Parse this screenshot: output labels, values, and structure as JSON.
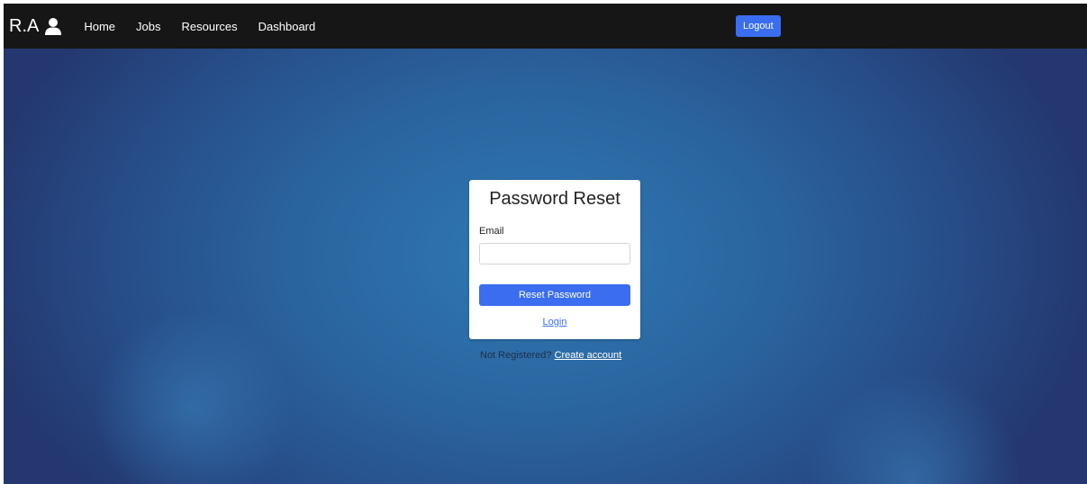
{
  "navbar": {
    "brand": "R.A",
    "brand_icon": "user-icon",
    "links": [
      {
        "label": "Home"
      },
      {
        "label": "Jobs"
      },
      {
        "label": "Resources"
      },
      {
        "label": "Dashboard"
      }
    ],
    "logout_label": "Logout"
  },
  "card": {
    "title": "Password Reset",
    "email_label": "Email",
    "email_value": "",
    "reset_button_label": "Reset Password",
    "login_link_label": "Login"
  },
  "register": {
    "prompt": "Not Registered?",
    "link_label": "Create account"
  },
  "colors": {
    "navbar_bg": "#161616",
    "accent": "#3a6df0",
    "background": "#2a639e"
  }
}
